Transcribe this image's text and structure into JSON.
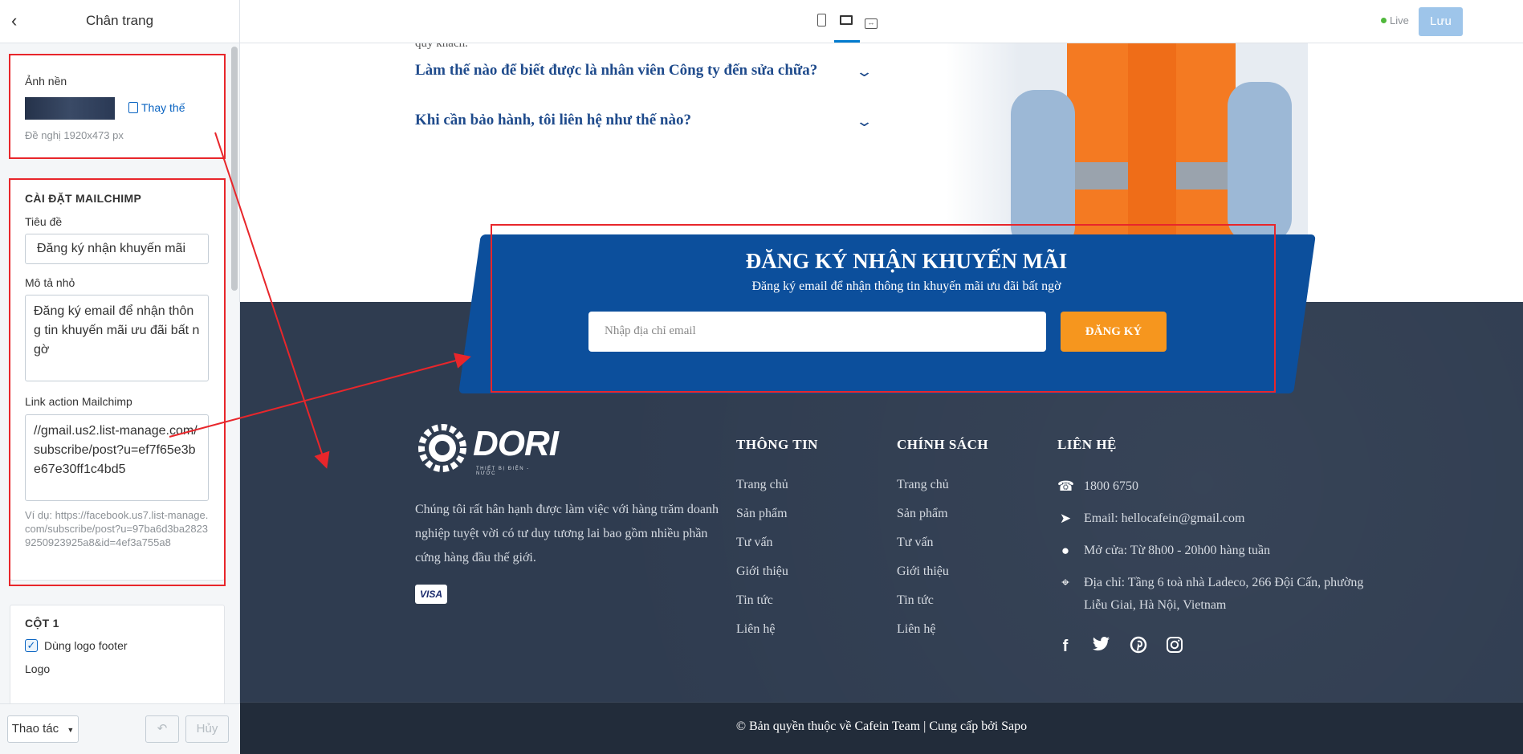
{
  "sidebar": {
    "title": "Chân trang",
    "background": {
      "label": "Ảnh nền",
      "replace_label": "Thay thế",
      "hint": "Đề nghị 1920x473 px"
    },
    "mailchimp": {
      "section_title": "CÀI ĐẶT MAILCHIMP",
      "title_label": "Tiêu đề",
      "title_value": "Đăng ký nhận khuyến mãi",
      "desc_label": "Mô tả nhỏ",
      "desc_value": "Đăng ký email để nhận thông tin khuyến mãi ưu đãi bất ngờ",
      "link_label": "Link action Mailchimp",
      "link_value": "//gmail.us2.list-manage.com/subscribe/post?u=ef7f65e3be67e30ff1c4bd5",
      "link_hint": "Ví dụ: https://facebook.us7.list-manage.com/subscribe/post?u=97ba6d3ba28239250923925a8&id=4ef3a755a8"
    },
    "col1": {
      "section_title": "CỘT 1",
      "use_logo_label": "Dùng logo footer",
      "logo_label": "Logo"
    },
    "footer": {
      "actions_label": "Thao tác",
      "cancel_label": "Hủy"
    }
  },
  "topbar": {
    "live_label": "Live",
    "save_label": "Lưu"
  },
  "preview": {
    "faq_top": "quý khách.",
    "faq": [
      "Làm thế nào để biết được là nhân viên Công ty đến sửa chữa?",
      "Khi cần bảo hành, tôi liên hệ như thế nào?"
    ],
    "promo": {
      "title": "ĐĂNG KÝ NHẬN KHUYẾN MÃI",
      "subtitle": "Đăng ký email để nhận thông tin khuyến mãi ưu đãi bất ngờ",
      "email_placeholder": "Nhập địa chỉ email",
      "button": "ĐĂNG KÝ"
    },
    "brand": {
      "name": "DORI",
      "tagline": "THIẾT BỊ ĐIỆN - NƯỚC"
    },
    "about": "Chúng tôi rất hân hạnh được làm việc với hàng trăm doanh nghiệp tuyệt vời có tư duy tương lai bao gồm nhiều phần cứng hàng đầu thế giới.",
    "visa": "VISA",
    "columns": {
      "info": {
        "title": "THÔNG TIN",
        "links": [
          "Trang chủ",
          "Sản phẩm",
          "Tư vấn",
          "Giới thiệu",
          "Tin tức",
          "Liên hệ"
        ]
      },
      "policy": {
        "title": "CHÍNH SÁCH",
        "links": [
          "Trang chủ",
          "Sản phẩm",
          "Tư vấn",
          "Giới thiệu",
          "Tin tức",
          "Liên hệ"
        ]
      },
      "contact": {
        "title": "LIÊN HỆ",
        "phone": "1800 6750",
        "email": "Email: hellocafein@gmail.com",
        "hours": "Mở cửa: Từ 8h00 - 20h00 hàng tuần",
        "address": "Địa chỉ: Tầng 6 toà nhà Ladeco, 266 Đội Cấn, phường Liễu Giai, Hà Nội, Vietnam"
      }
    },
    "copyright": "© Bản quyền thuộc về Cafein Team | Cung cấp bởi Sapo"
  },
  "colors": {
    "promo_bg": "#0c4f9c",
    "footer_bg": "#2f3c50",
    "accent_orange": "#f6961e",
    "annotation_red": "#e8262b",
    "link_blue": "#0a64c2"
  }
}
